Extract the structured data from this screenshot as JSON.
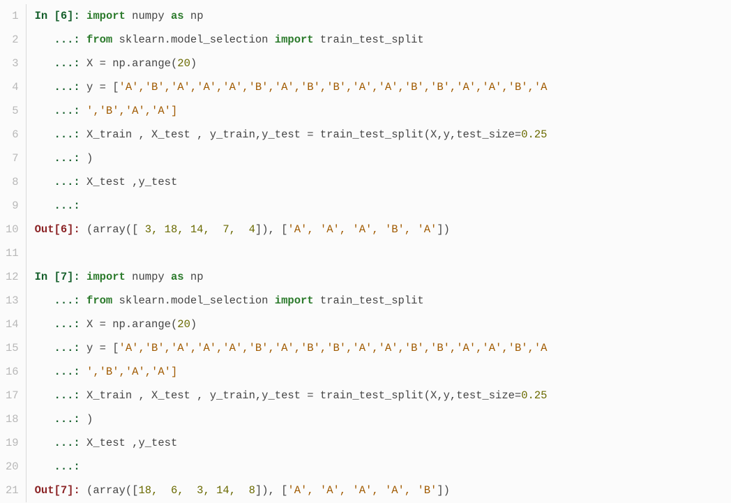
{
  "gutter": [
    "1",
    "2",
    "3",
    "4",
    "5",
    "6",
    "7",
    "8",
    "9",
    "10",
    "11",
    "12",
    "13",
    "14",
    "15",
    "16",
    "17",
    "18",
    "19",
    "20",
    "21"
  ],
  "prompts": {
    "in6": "In [",
    "in7": "In [",
    "out6": "Out[",
    "out7": "Out[",
    "n6": "6",
    "n7": "7",
    "close": "]: ",
    "cont": "   ...: "
  },
  "tokens": {
    "import": "import",
    "as": "as",
    "from": "from",
    "numpy": " numpy ",
    "np": " np",
    "sklearn": " sklearn.model_selection ",
    "tts": " train_test_split",
    "x_eq": "X = np.arange(",
    "twenty": "20",
    "close_paren": ")",
    "y_eq": "y = [",
    "y_list_head": "'A','B','A','A','A','B','A','B','B','A','A','B','B','A','A','B','A",
    "y_list_tail": "','B','A','A']",
    "split_call_pre": "X_train , X_test , y_train,y_test = train_test_split(X,y,test_size=",
    "zero25": "0.25",
    "only_paren": ")",
    "xytest": "X_test ,y_test"
  },
  "outputs": {
    "o6_pre": "(array([ ",
    "o6_nums": "3, 18, 14,  7,  4",
    "o6_mid": "]), [",
    "o6_strs": "'A', 'A', 'A', 'B', 'A'",
    "o6_end": "])",
    "o7_pre": "(array([",
    "o7_nums": "18,  6,  3, 14,  8",
    "o7_mid": "]), [",
    "o7_strs": "'A', 'A', 'A', 'A', 'B'",
    "o7_end": "])"
  }
}
